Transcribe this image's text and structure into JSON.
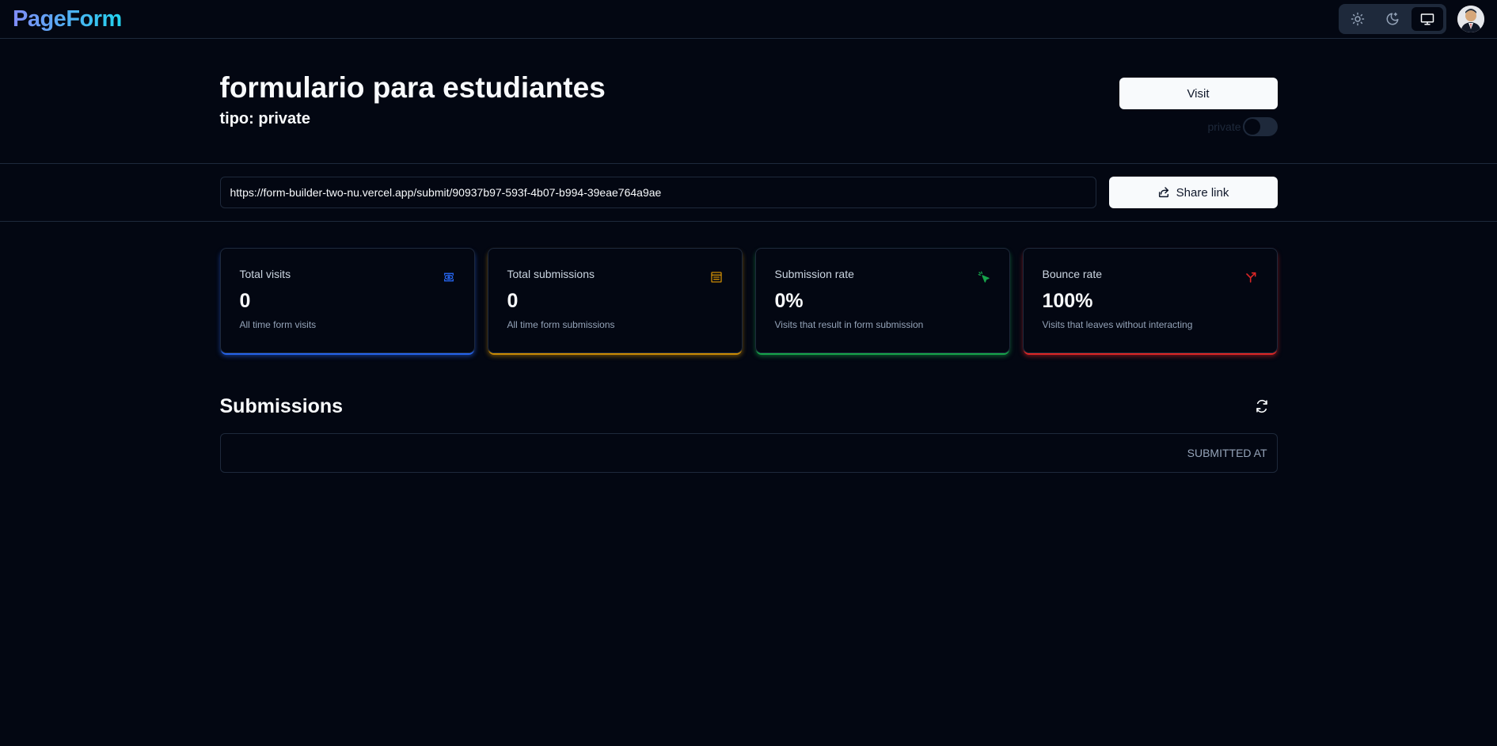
{
  "nav": {
    "logo": "PageForm",
    "theme_modes": [
      "light",
      "dark",
      "system"
    ],
    "active_theme": "system"
  },
  "header": {
    "title": "formulario para estudiantes",
    "type_line": "tipo: private",
    "visit_label": "Visit",
    "toggle_label": "private",
    "toggle_on": false
  },
  "share": {
    "url": "https://form-builder-two-nu.vercel.app/submit/90937b97-593f-4b07-b994-39eae764a9ae",
    "button_label": "Share link"
  },
  "stats": [
    {
      "title": "Total visits",
      "value": "0",
      "help": "All time form visits",
      "color": "#2563eb",
      "icon": "eye-icon"
    },
    {
      "title": "Total submissions",
      "value": "0",
      "help": "All time form submissions",
      "color": "#ca8a04",
      "icon": "form-icon"
    },
    {
      "title": "Submission rate",
      "value": "0%",
      "help": "Visits that result in form submission",
      "color": "#16a34a",
      "icon": "cursor-click-icon"
    },
    {
      "title": "Bounce rate",
      "value": "100%",
      "help": "Visits that leaves without interacting",
      "color": "#dc2626",
      "icon": "split-arrow-icon"
    }
  ],
  "submissions": {
    "title": "Submissions",
    "columns": [
      "Submitted at"
    ]
  }
}
